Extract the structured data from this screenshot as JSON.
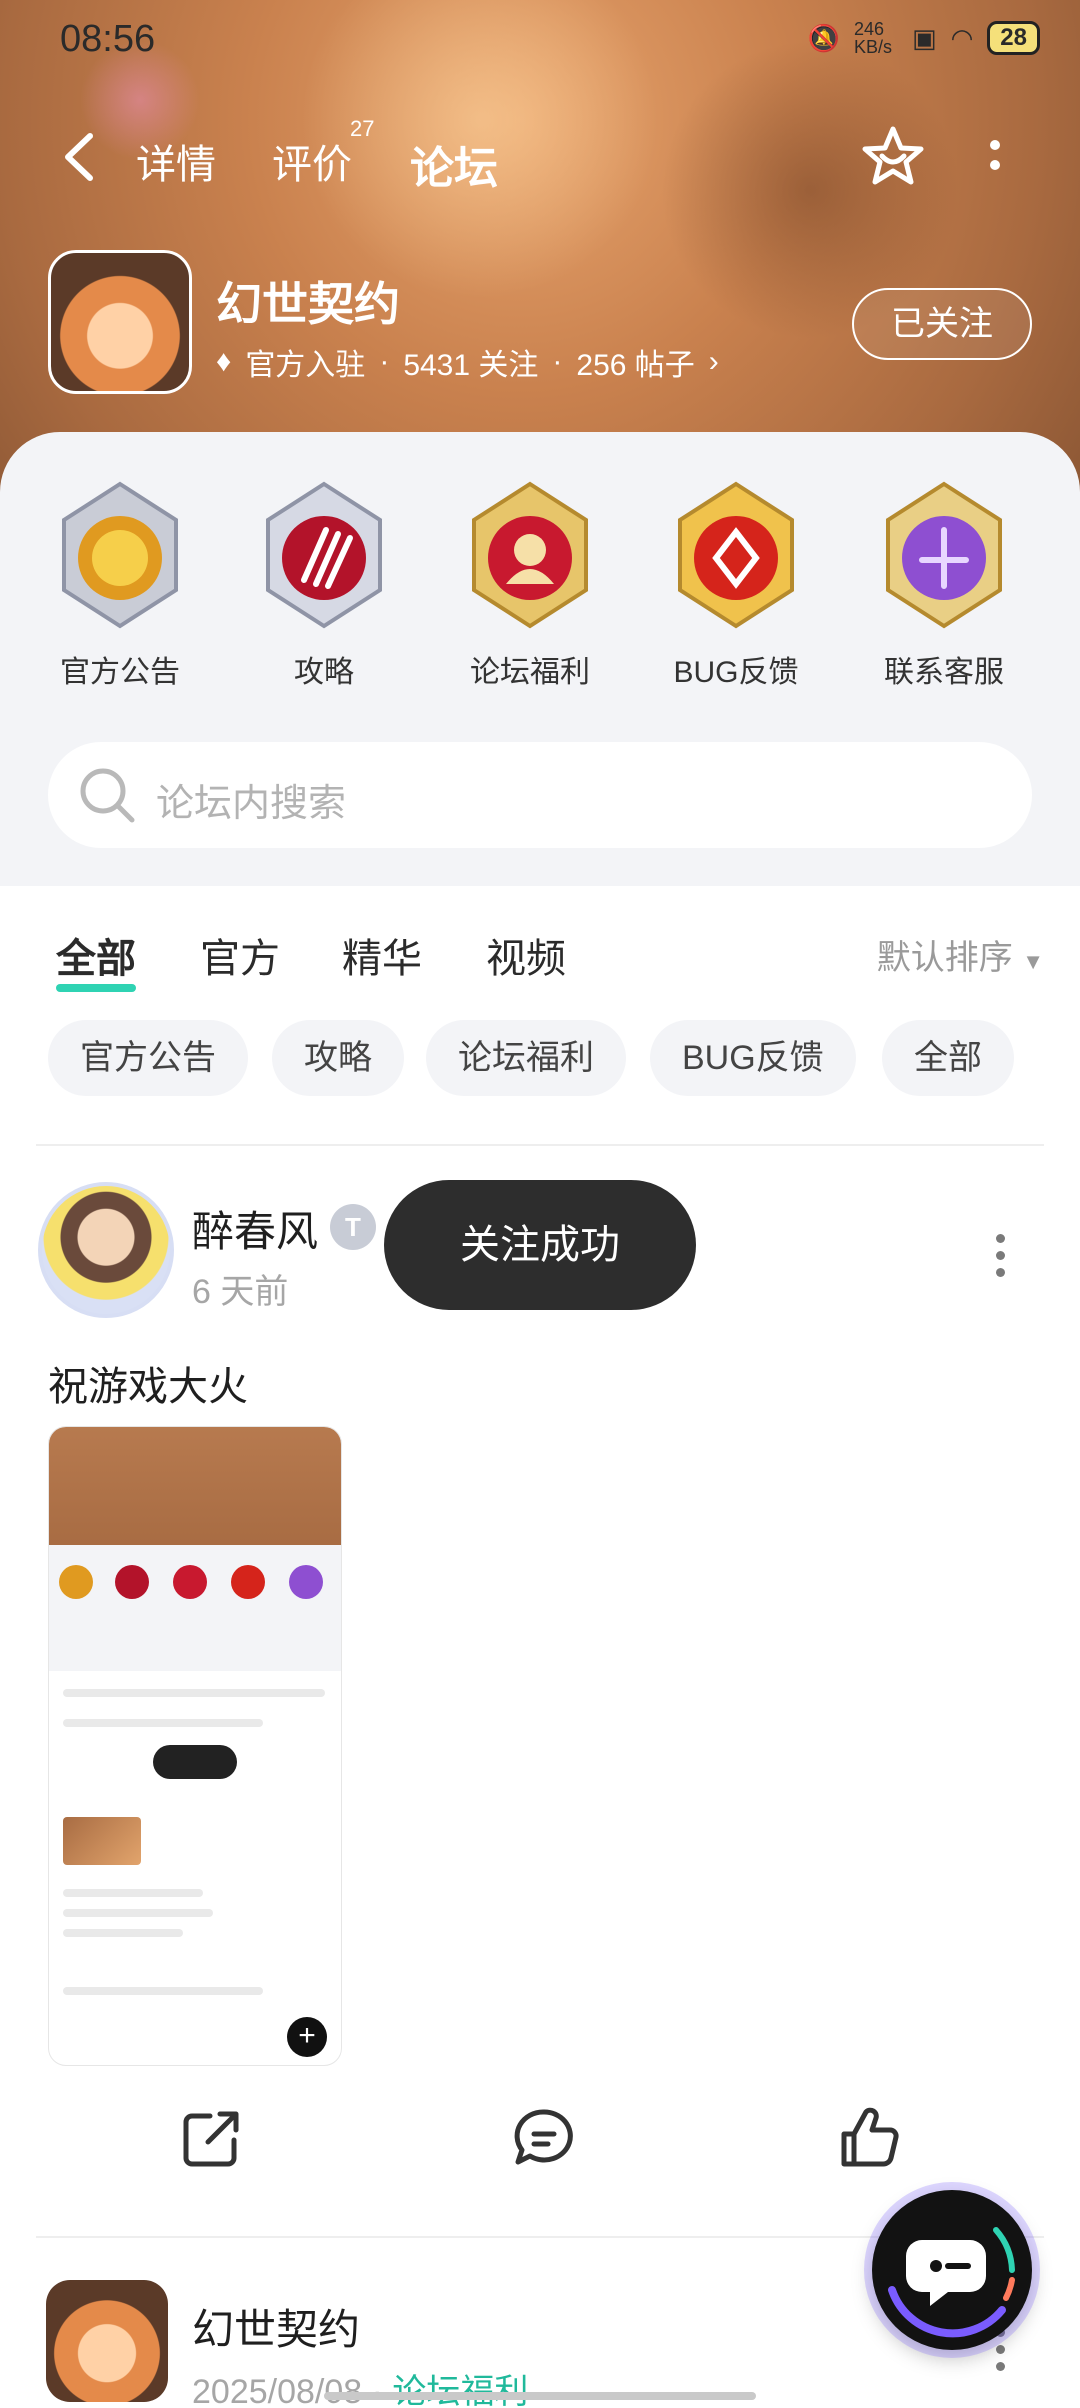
{
  "status_bar": {
    "time": "08:56",
    "speed": "246 KB/s",
    "battery": "28"
  },
  "nav": {
    "tabs": [
      {
        "label": "详情"
      },
      {
        "label": "评价"
      },
      {
        "label": "论坛"
      }
    ],
    "review_count": "27"
  },
  "game": {
    "name": "幻世契约",
    "badge": "官方入驻",
    "followers": "5431 关注",
    "posts": "256 帖子",
    "follow_button": "已关注"
  },
  "categories": [
    {
      "label": "官方公告"
    },
    {
      "label": "攻略"
    },
    {
      "label": "论坛福利"
    },
    {
      "label": "BUG反馈"
    },
    {
      "label": "联系客服"
    }
  ],
  "search": {
    "placeholder": "论坛内搜索"
  },
  "feed_tabs": [
    {
      "label": "全部"
    },
    {
      "label": "官方"
    },
    {
      "label": "精华"
    },
    {
      "label": "视频"
    }
  ],
  "sort": {
    "label": "默认排序"
  },
  "chips": [
    {
      "label": "官方公告"
    },
    {
      "label": "攻略"
    },
    {
      "label": "论坛福利"
    },
    {
      "label": "BUG反馈"
    },
    {
      "label": "全部"
    }
  ],
  "post1": {
    "author": "醉春风",
    "level": "T",
    "time": "6 天前",
    "title": "祝游戏大火"
  },
  "toast": "关注成功",
  "post2": {
    "author": "幻世契约",
    "date": "2025/08/08",
    "tag": "论坛福利"
  },
  "colors": {
    "accent": "#2fd3b3",
    "header": "#b9784a",
    "tag_green": "#20b99b"
  }
}
